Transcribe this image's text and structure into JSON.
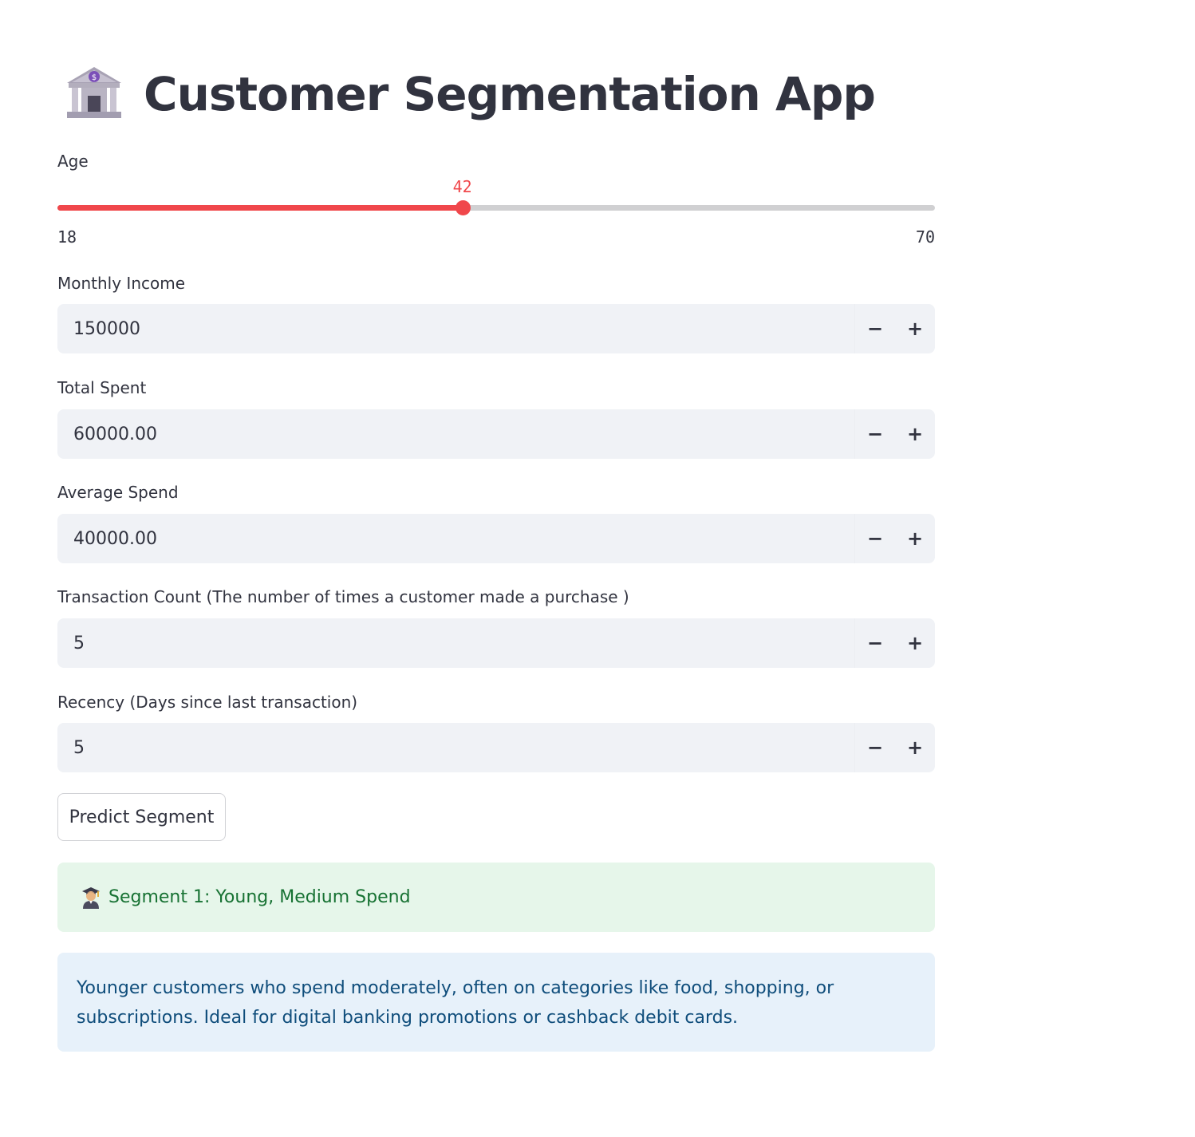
{
  "app": {
    "title": "Customer Segmentation App",
    "title_icon": "bank-icon"
  },
  "age": {
    "label": "Age",
    "min": 18,
    "max": 70,
    "value": 42,
    "min_label": "18",
    "max_label": "70",
    "value_label": "42"
  },
  "fields": [
    {
      "label": "Monthly Income",
      "value": "150000"
    },
    {
      "label": "Total Spent",
      "value": "60000.00"
    },
    {
      "label": "Average Spend",
      "value": "40000.00"
    },
    {
      "label": "Transaction Count (The number of times a customer made a purchase )",
      "value": "5"
    },
    {
      "label": "Recency (Days since last transaction)",
      "value": "5"
    }
  ],
  "stepper": {
    "minus_label": "−",
    "plus_label": "+"
  },
  "predict_button": {
    "label": "Predict Segment"
  },
  "result": {
    "icon": "student-icon",
    "text": "Segment 1: Young, Medium Spend"
  },
  "info": {
    "text": "Younger customers who spend moderately, often on categories like food, shopping, or subscriptions. Ideal for digital banking promotions or cashback debit cards."
  },
  "colors": {
    "accent": "#f0474b",
    "success_bg": "#e6f6ea",
    "success_text": "#177233",
    "info_bg": "#e7f1fa",
    "info_text": "#0f4d7b",
    "input_bg": "#f0f2f6",
    "text": "#31333f"
  }
}
